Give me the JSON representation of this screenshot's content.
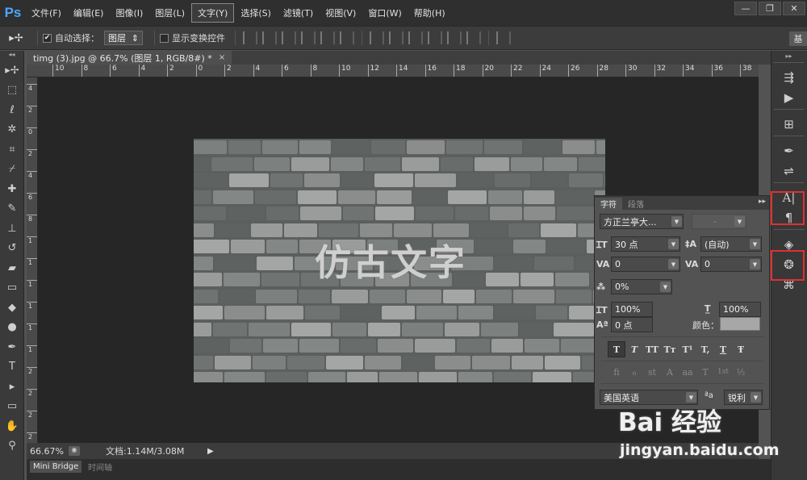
{
  "app": {
    "logo": "Ps"
  },
  "menu": [
    "文件(F)",
    "编辑(E)",
    "图像(I)",
    "图层(L)",
    "文字(Y)",
    "选择(S)",
    "滤镜(T)",
    "视图(V)",
    "窗口(W)",
    "帮助(H)"
  ],
  "menu_active": "文字(Y)",
  "window_controls": {
    "minimize": "—",
    "restore": "❐",
    "close": "✕"
  },
  "options_bar": {
    "tool_icon": "move-tool-icon",
    "auto_select_label": "自动选择：",
    "auto_select_checked": true,
    "auto_select_value": "图层",
    "show_transform_label": "显示变换控件",
    "show_transform_checked": false,
    "workspace_label": "基"
  },
  "document": {
    "tab_title": "timg (3).jpg @ 66.7% (图层 1, RGB/8#) *",
    "close": "×",
    "canvas_text": "仿古文字",
    "zoom": "66.67%",
    "doc_size": "文档:1.14M/3.08M"
  },
  "ruler_top": [
    "10",
    "8",
    "6",
    "4",
    "2",
    "0",
    "2",
    "4",
    "6",
    "8",
    "10",
    "12",
    "14",
    "16",
    "18",
    "20",
    "22",
    "24",
    "26",
    "28",
    "30",
    "32",
    "34",
    "36",
    "38"
  ],
  "ruler_left": [
    "4",
    "2",
    "0",
    "2",
    "4",
    "6",
    "8",
    "1",
    "1",
    "1",
    "1",
    "1",
    "1",
    "2",
    "2",
    "2",
    "2"
  ],
  "bottom_tabs": [
    "Mini Bridge",
    "时间轴"
  ],
  "character_panel": {
    "tabs": [
      "字符",
      "段落"
    ],
    "menu_icon": "▸▸",
    "font_family": "方正兰亭大...",
    "font_style": "-",
    "font_size": "30 点",
    "leading": "(自动)",
    "kerning": "0",
    "tracking": "0",
    "tsume": "0%",
    "vertical_scale": "100%",
    "horizontal_scale": "100%",
    "baseline_shift": "0 点",
    "color_label": "颜色：",
    "color_value": "#a7a7a7",
    "style_buttons": [
      "T",
      "T",
      "TT",
      "Tт",
      "T¹",
      "T,",
      "T",
      "Ŧ"
    ],
    "opentype_buttons": [
      "fi",
      "ℴ",
      "st",
      "A",
      "aa",
      "T",
      "1st",
      "½"
    ],
    "language": "美国英语",
    "aa_label": "ªa",
    "antialias": "锐利"
  },
  "watermark": {
    "logo": "Bai 经验",
    "url": "jingyan.baidu.com"
  }
}
